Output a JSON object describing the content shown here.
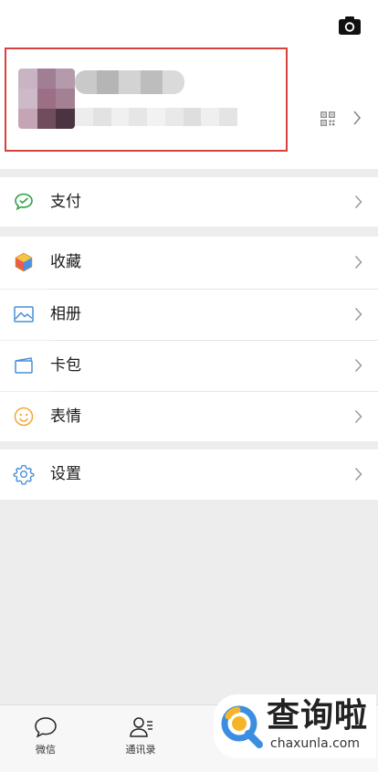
{
  "profile": {
    "camera_icon": "camera-icon",
    "qr_icon": "qr-code-icon",
    "chevron_icon": "chevron-right-icon"
  },
  "colors": {
    "highlight": "#d9413d",
    "pay_green": "#2ba245",
    "blue": "#4b8fd6",
    "orange": "#f2a838"
  },
  "menu": {
    "pay": "支付",
    "favorites": "收藏",
    "album": "相册",
    "cards": "卡包",
    "stickers": "表情",
    "settings": "设置"
  },
  "tabbar": {
    "chats": "微信",
    "contacts": "通讯录"
  },
  "watermark": {
    "title": "查询啦",
    "url": "chaxunla.com"
  }
}
